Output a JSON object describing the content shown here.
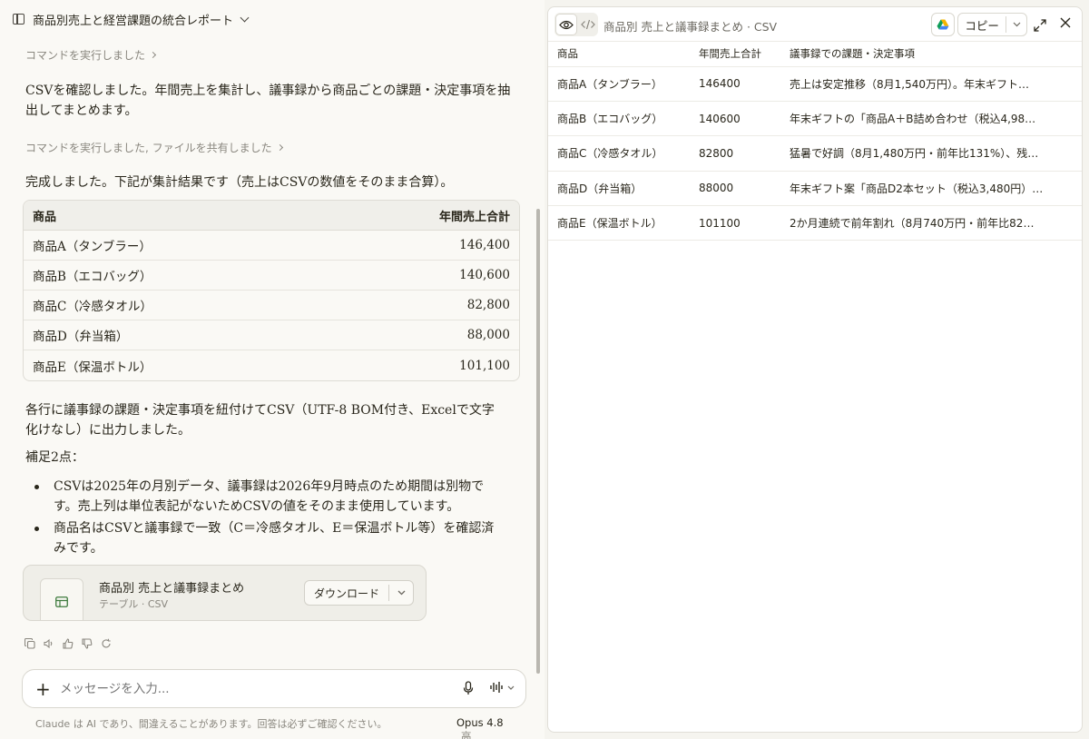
{
  "header": {
    "title": "商品別売上と経営課題の統合レポート"
  },
  "chat": {
    "command1": "コマンドを実行しました",
    "message1": "CSVを確認しました。年間売上を集計し、議事録から商品ごとの課題・決定事項を抽出してまとめます。",
    "command2": "コマンドを実行しました, ファイルを共有しました",
    "message2": "完成しました。下記が集計結果です（売上はCSVの数値をそのまま合算）。",
    "table": {
      "headers": [
        "商品",
        "年間売上合計"
      ],
      "rows": [
        {
          "product": "商品A（タンブラー）",
          "total": "146,400"
        },
        {
          "product": "商品B（エコバッグ）",
          "total": "140,600"
        },
        {
          "product": "商品C（冷感タオル）",
          "total": "82,800"
        },
        {
          "product": "商品D（弁当箱）",
          "total": "88,000"
        },
        {
          "product": "商品E（保温ボトル）",
          "total": "101,100"
        }
      ]
    },
    "message3": "各行に議事録の課題・決定事項を紐付けてCSV（UTF-8 BOM付き、Excelで文字化けなし）に出力しました。",
    "note_title": "補足2点：",
    "notes": [
      "CSVは2025年の月別データ、議事録は2026年9月時点のため期間は別物です。売上列は単位表記がないためCSVの値をそのまま使用しています。",
      "商品名はCSVと議事録で一致（C＝冷感タオル、E＝保温ボトル等）を確認済みです。"
    ],
    "artifact": {
      "title": "商品別 売上と議事録まとめ",
      "subtitle": "テーブル · CSV",
      "download_label": "ダウンロード"
    }
  },
  "composer": {
    "placeholder": "メッセージを入力...",
    "disclaimer": "Claude は AI であり、間違えることがあります。回答は必ずご確認ください。",
    "model": "Opus 4.8",
    "effort": "高"
  },
  "panel": {
    "title": "商品別 売上と議事録まとめ · CSV",
    "copy_label": "コピー",
    "columns": [
      "商品",
      "年間売上合計",
      "議事録での課題・決定事項"
    ],
    "rows": [
      {
        "product": "商品A（タンブラー）",
        "total": "146400",
        "notes": "売上は安定推移（8月1,540万円）。年末ギフト…"
      },
      {
        "product": "商品B（エコバッグ）",
        "total": "140600",
        "notes": "年末ギフトの「商品A＋B詰め合わせ（税込4,98…"
      },
      {
        "product": "商品C（冷感タオル）",
        "total": "82800",
        "notes": "猛暑で好調（8月1,480万円・前年比131%）、残…"
      },
      {
        "product": "商品D（弁当箱）",
        "total": "88000",
        "notes": "年末ギフト案「商品D2本セット（税込3,480円）…"
      },
      {
        "product": "商品E（保温ボトル）",
        "total": "101100",
        "notes": "2か月連続で前年割れ（8月740万円・前年比82…"
      }
    ]
  },
  "colors": {
    "background": "#faf9f5",
    "text": "#29261b",
    "muted": "#8a877f",
    "panel_bg": "#ffffff"
  }
}
